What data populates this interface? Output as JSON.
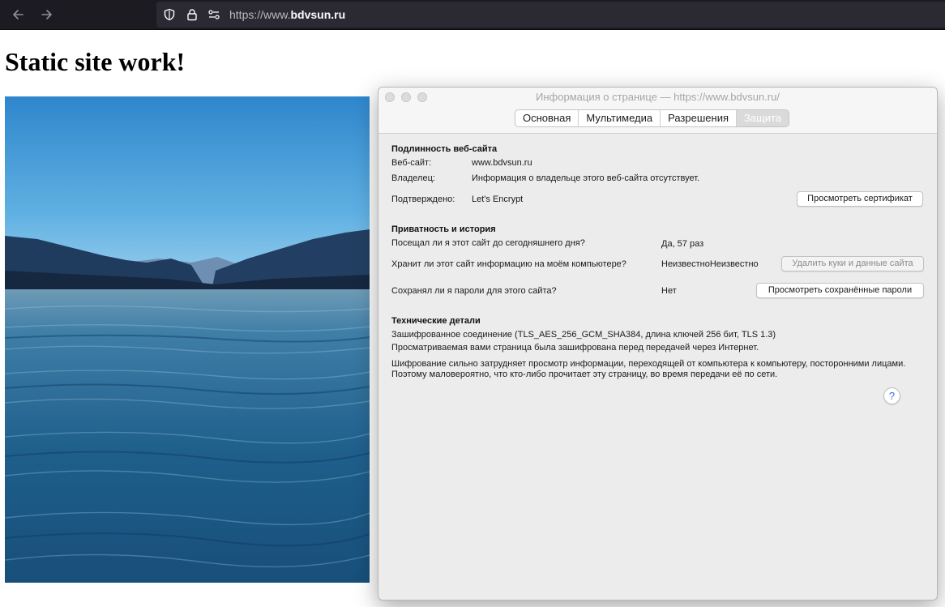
{
  "browser": {
    "url_prefix": "https://www.",
    "url_domain": "bdvsun.ru",
    "back_icon": "arrow-left-icon",
    "forward_icon": "arrow-right-icon"
  },
  "page": {
    "heading": "Static site work!"
  },
  "dialog": {
    "title": "Информация о странице — https://www.bdvsun.ru/",
    "tabs": [
      "Основная",
      "Мультимедиа",
      "Разрешения",
      "Защита"
    ],
    "active_tab": "Защита",
    "identity": {
      "title": "Подлинность веб-сайта",
      "website_label": "Веб-сайт:",
      "website_value": "www.bdvsun.ru",
      "owner_label": "Владелец:",
      "owner_value": "Информация о владельце этого веб-сайта отсутствует.",
      "verified_label": "Подтверждено:",
      "verified_value": "Let's Encrypt",
      "view_cert_button": "Просмотреть сертификат"
    },
    "privacy": {
      "title": "Приватность и история",
      "visited_label": "Посещал ли я этот сайт до сегодняшнего дня?",
      "visited_value": "Да, 57 раз",
      "storage_label": "Хранит ли этот сайт информацию на моём компьютере?",
      "storage_value": "НеизвестноНеизвестно",
      "clear_cookies_button": "Удалить куки и данные сайта",
      "passwords_label": "Сохранял ли я пароли для этого сайта?",
      "passwords_value": "Нет",
      "view_passwords_button": "Просмотреть сохранённые пароли"
    },
    "technical": {
      "title": "Технические детали",
      "line1": "Зашифрованное соединение (TLS_AES_256_GCM_SHA384, длина ключей 256 бит, TLS 1.3)",
      "line2": "Просматриваемая вами страница была зашифрована перед передачей через Интернет.",
      "line3": "Шифрование сильно затрудняет просмотр информации, переходящей от компьютера к компьютеру, посторонними лицами. Поэтому маловероятно, что кто-либо прочитает эту страницу, во время передачи её по сети."
    },
    "help_label": "?"
  }
}
